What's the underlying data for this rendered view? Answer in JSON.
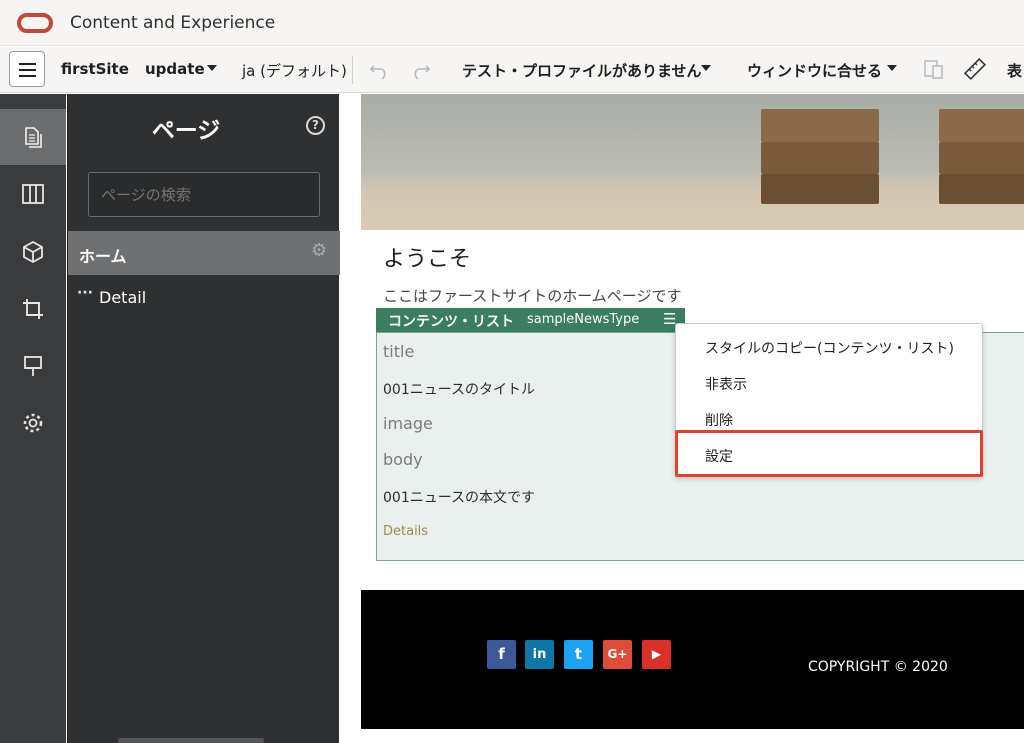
{
  "app": {
    "title": "Content and Experience"
  },
  "toolbar": {
    "site_name": "firstSite",
    "update_label": "update",
    "language": "ja (デフォルト)",
    "test_profile": "テスト・プロファイルがありません",
    "fit_window": "ウィンドウに合せる",
    "display_label": "表"
  },
  "sidebar": {
    "title": "ページ",
    "help": "?",
    "search_placeholder": "ページの検索",
    "pages": [
      {
        "label": "ホーム",
        "selected": true
      },
      {
        "label": "Detail",
        "selected": false,
        "prefix": "···"
      }
    ],
    "rail_icons": [
      "pages-icon",
      "layout-icon",
      "components-icon",
      "crop-icon",
      "theme-brush-icon",
      "settings-gear-icon"
    ]
  },
  "canvas": {
    "welcome": "ようこそ",
    "intro": "ここはファーストサイトのホームページです",
    "content_list": {
      "title": "コンテンツ・リスト",
      "type": "sampleNewsType",
      "fields": [
        {
          "label": "title"
        },
        {
          "value": "001ニュースのタイトル"
        },
        {
          "label": "image"
        },
        {
          "label": "body"
        },
        {
          "value": "001ニュースの本文です"
        }
      ],
      "link": "Details"
    },
    "footer": {
      "social": [
        "f",
        "in",
        "t",
        "G+",
        "▶"
      ],
      "copyright": "COPYRIGHT © 2020"
    }
  },
  "context_menu": {
    "items": [
      "スタイルのコピー(コンテンツ・リスト)",
      "非表示",
      "削除",
      "設定"
    ],
    "highlighted": "設定"
  },
  "colors": {
    "oracle_red": "#c74634",
    "content_list_header": "#3b7d61",
    "highlight_border": "#e4402a",
    "facebook": "#3b5998",
    "linkedin": "#0e76a8",
    "twitter": "#1da1f2",
    "googleplus": "#dd4b39",
    "youtube": "#d9302a"
  }
}
